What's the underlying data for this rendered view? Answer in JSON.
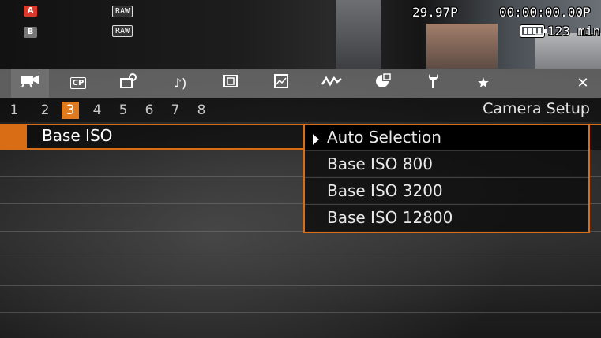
{
  "status": {
    "left_icons": [
      {
        "icon": "audio-a-off-icon",
        "label": "A",
        "color": "#d83a2c"
      },
      {
        "icon": "audio-b-off-icon",
        "label": "B",
        "color": "#777777"
      }
    ],
    "raw_labels": [
      "RAW",
      "RAW"
    ],
    "framerate": "29.97P",
    "timecode": "00:00:00.00P",
    "battery_icon": "battery-icon",
    "record_time": "123 min"
  },
  "tabs": [
    {
      "icon": "camera-icon",
      "glyph": "🎥",
      "active": true
    },
    {
      "icon": "cp-icon",
      "glyph": "CP"
    },
    {
      "icon": "camera-settings-icon",
      "glyph": "⚙"
    },
    {
      "icon": "audio-icon",
      "glyph": "♪)"
    },
    {
      "icon": "film-icon",
      "glyph": "▣"
    },
    {
      "icon": "assist-icon",
      "glyph": "▤"
    },
    {
      "icon": "waveform-icon",
      "glyph": "∿"
    },
    {
      "icon": "media-icon",
      "glyph": "◉"
    },
    {
      "icon": "wrench-icon",
      "glyph": "🔧"
    },
    {
      "icon": "star-icon",
      "glyph": "★"
    },
    {
      "icon": "close-icon",
      "glyph": "✕"
    }
  ],
  "pages": [
    "1",
    "2",
    "3",
    "4",
    "5",
    "6",
    "7",
    "8"
  ],
  "active_page": "3",
  "page_title": "Camera Setup",
  "menu": {
    "item_label": "Base ISO",
    "options": [
      {
        "label": "Auto Selection",
        "selected": true
      },
      {
        "label": "Base ISO 800"
      },
      {
        "label": "Base ISO 3200"
      },
      {
        "label": "Base ISO 12800"
      }
    ]
  },
  "colors": {
    "accent": "#d86d16",
    "tabbar": "#8c8c8c"
  }
}
